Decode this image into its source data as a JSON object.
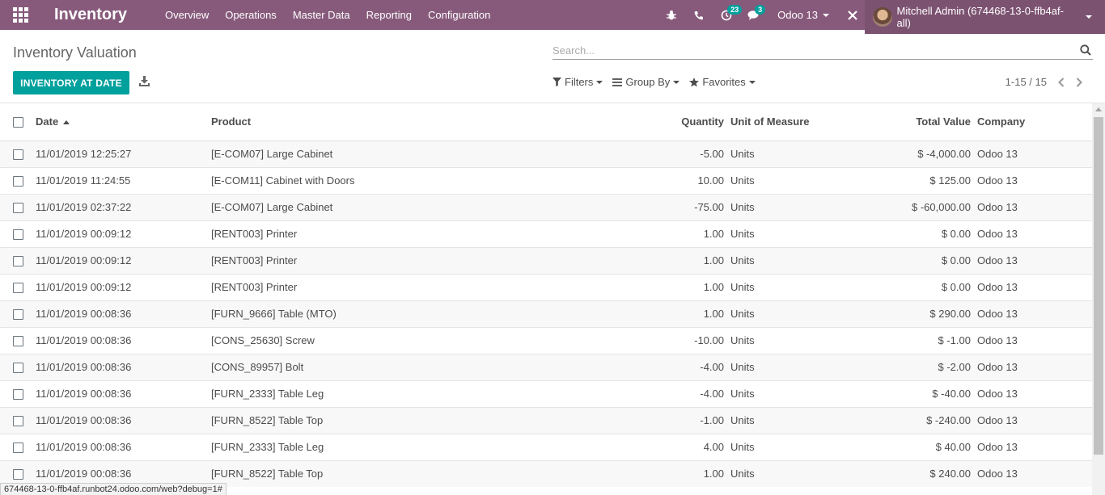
{
  "navbar": {
    "app_title": "Inventory",
    "menu": [
      "Overview",
      "Operations",
      "Master Data",
      "Reporting",
      "Configuration"
    ],
    "activity_count": "23",
    "message_count": "3",
    "company": "Odoo 13",
    "user": "Mitchell Admin (674468-13-0-ffb4af-all)"
  },
  "control": {
    "title": "Inventory Valuation",
    "search_placeholder": "Search...",
    "primary_button": "INVENTORY AT DATE",
    "filters_label": "Filters",
    "groupby_label": "Group By",
    "favorites_label": "Favorites",
    "pager": "1-15 / 15"
  },
  "table": {
    "headers": {
      "date": "Date",
      "product": "Product",
      "quantity": "Quantity",
      "uom": "Unit of Measure",
      "total_value": "Total Value",
      "company": "Company"
    },
    "rows": [
      {
        "date": "11/01/2019 12:25:27",
        "product": "[E-COM07] Large Cabinet",
        "quantity": "-5.00",
        "uom": "Units",
        "total_value": "$ -4,000.00",
        "company": "Odoo 13"
      },
      {
        "date": "11/01/2019 11:24:55",
        "product": "[E-COM11] Cabinet with Doors",
        "quantity": "10.00",
        "uom": "Units",
        "total_value": "$ 125.00",
        "company": "Odoo 13"
      },
      {
        "date": "11/01/2019 02:37:22",
        "product": "[E-COM07] Large Cabinet",
        "quantity": "-75.00",
        "uom": "Units",
        "total_value": "$ -60,000.00",
        "company": "Odoo 13"
      },
      {
        "date": "11/01/2019 00:09:12",
        "product": "[RENT003] Printer",
        "quantity": "1.00",
        "uom": "Units",
        "total_value": "$ 0.00",
        "company": "Odoo 13"
      },
      {
        "date": "11/01/2019 00:09:12",
        "product": "[RENT003] Printer",
        "quantity": "1.00",
        "uom": "Units",
        "total_value": "$ 0.00",
        "company": "Odoo 13"
      },
      {
        "date": "11/01/2019 00:09:12",
        "product": "[RENT003] Printer",
        "quantity": "1.00",
        "uom": "Units",
        "total_value": "$ 0.00",
        "company": "Odoo 13"
      },
      {
        "date": "11/01/2019 00:08:36",
        "product": "[FURN_9666] Table (MTO)",
        "quantity": "1.00",
        "uom": "Units",
        "total_value": "$ 290.00",
        "company": "Odoo 13"
      },
      {
        "date": "11/01/2019 00:08:36",
        "product": "[CONS_25630] Screw",
        "quantity": "-10.00",
        "uom": "Units",
        "total_value": "$ -1.00",
        "company": "Odoo 13"
      },
      {
        "date": "11/01/2019 00:08:36",
        "product": "[CONS_89957] Bolt",
        "quantity": "-4.00",
        "uom": "Units",
        "total_value": "$ -2.00",
        "company": "Odoo 13"
      },
      {
        "date": "11/01/2019 00:08:36",
        "product": "[FURN_2333] Table Leg",
        "quantity": "-4.00",
        "uom": "Units",
        "total_value": "$ -40.00",
        "company": "Odoo 13"
      },
      {
        "date": "11/01/2019 00:08:36",
        "product": "[FURN_8522] Table Top",
        "quantity": "-1.00",
        "uom": "Units",
        "total_value": "$ -240.00",
        "company": "Odoo 13"
      },
      {
        "date": "11/01/2019 00:08:36",
        "product": "[FURN_2333] Table Leg",
        "quantity": "4.00",
        "uom": "Units",
        "total_value": "$ 40.00",
        "company": "Odoo 13"
      },
      {
        "date": "11/01/2019 00:08:36",
        "product": "[FURN_8522] Table Top",
        "quantity": "1.00",
        "uom": "Units",
        "total_value": "$ 240.00",
        "company": "Odoo 13"
      }
    ]
  },
  "statusbar": "674468-13-0-ffb4af.runbot24.odoo.com/web?debug=1#",
  "colors": {
    "brand": "#875a7b",
    "accent": "#00a09d"
  }
}
